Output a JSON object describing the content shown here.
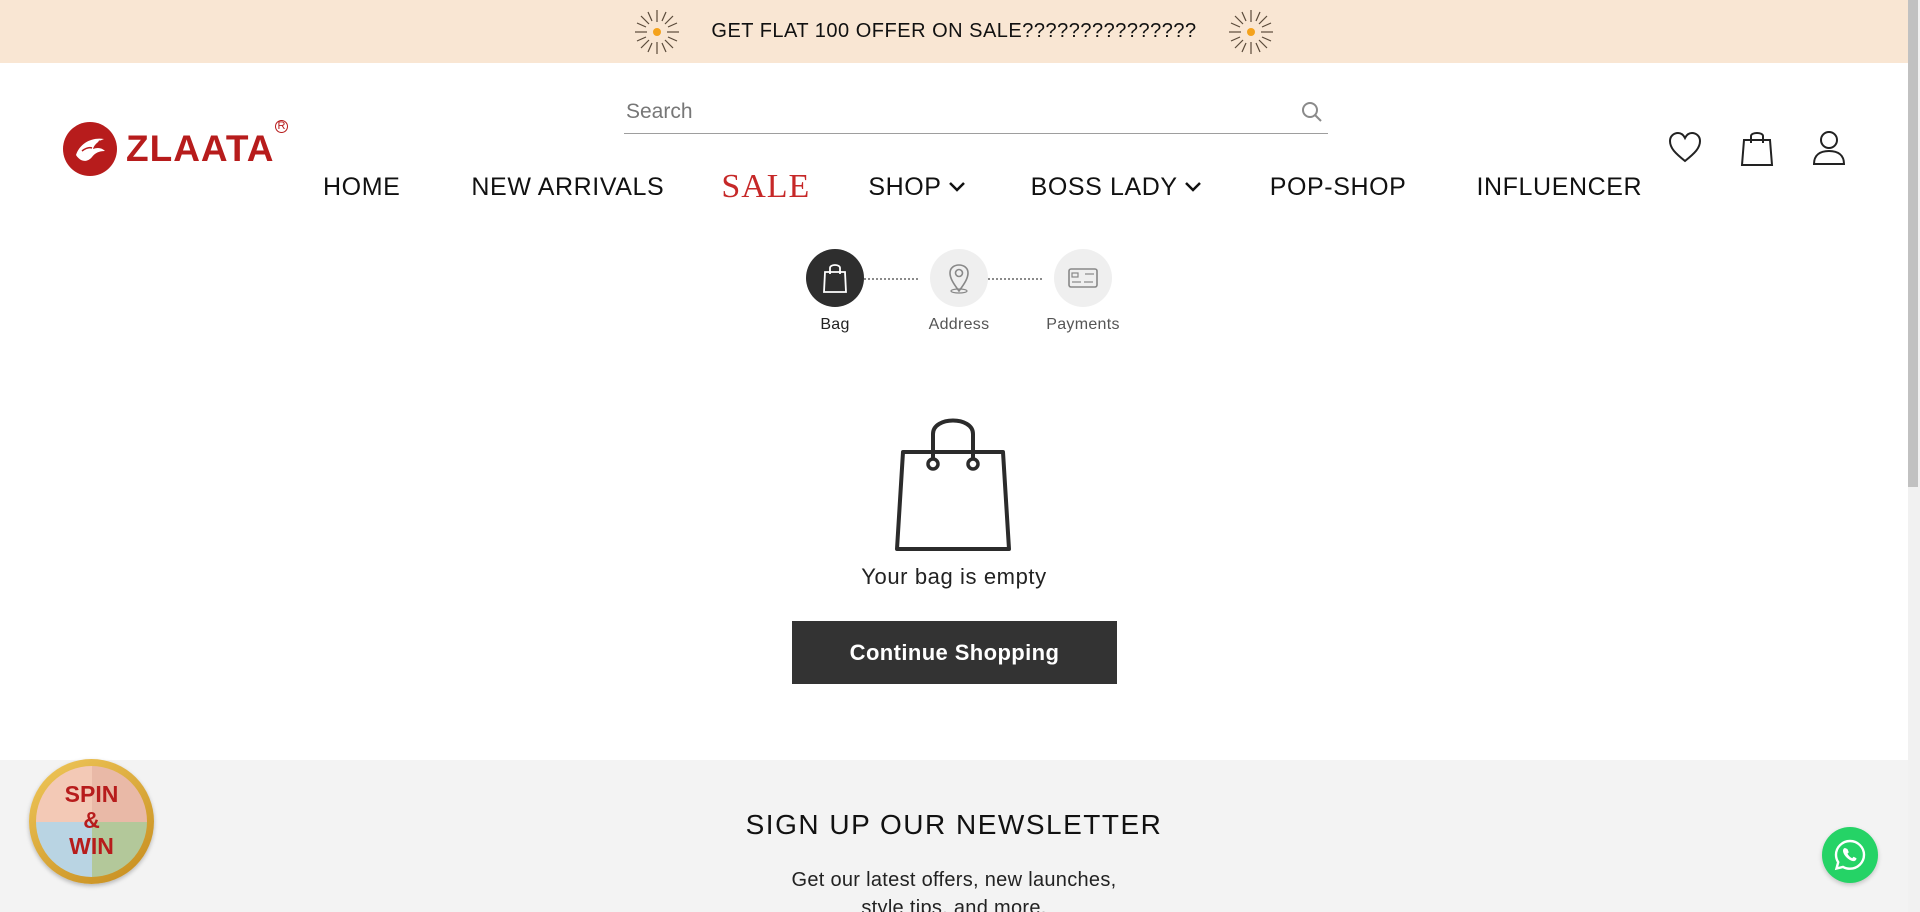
{
  "announcement": {
    "text": "GET FLAT 100 OFFER ON SALE???????????????"
  },
  "brand": {
    "name": "ZLAATA",
    "registered": "R",
    "color": "#b71c1c"
  },
  "search": {
    "placeholder": "Search"
  },
  "nav": {
    "home": "HOME",
    "new_arrivals": "NEW ARRIVALS",
    "sale": "SALE",
    "shop": "SHOP",
    "boss_lady": "BOSS LADY",
    "pop_shop": "POP-SHOP",
    "influencer": "INFLUENCER"
  },
  "header_icons": [
    "heart-icon",
    "bag-icon",
    "user-icon"
  ],
  "checkout_steps": [
    {
      "label": "Bag",
      "icon": "bag-icon",
      "active": true
    },
    {
      "label": "Address",
      "icon": "location-pin-icon",
      "active": false
    },
    {
      "label": "Payments",
      "icon": "credit-card-icon",
      "active": false
    }
  ],
  "cart": {
    "empty_message": "Your bag is empty",
    "continue_label": "Continue Shopping"
  },
  "newsletter": {
    "title": "SIGN UP OUR NEWSLETTER",
    "subtitle_line1": "Get our latest offers, new launches,",
    "subtitle_line2": "style tips, and more."
  },
  "spin_widget": {
    "line1": "SPIN",
    "line2": "&",
    "line3": "WIN"
  },
  "colors": {
    "announcement_bg": "#f9e6d3",
    "accent": "#c62828",
    "button_dark": "#333333",
    "whatsapp": "#25d366"
  }
}
